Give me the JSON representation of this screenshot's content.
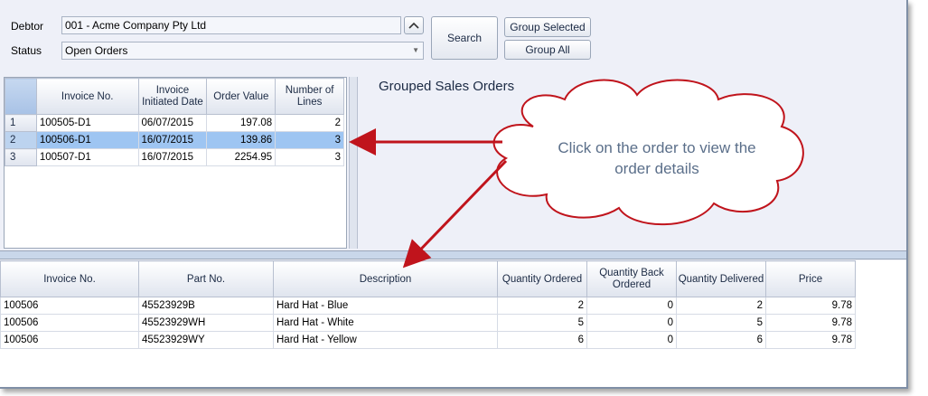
{
  "filters": {
    "debtor_label": "Debtor",
    "debtor_value": "001 - Acme Company Pty Ltd",
    "status_label": "Status",
    "status_value": "Open Orders"
  },
  "buttons": {
    "search": "Search",
    "group_selected": "Group Selected",
    "group_all": "Group All"
  },
  "orders_grid": {
    "headers": [
      "Invoice No.",
      "Invoice Initiated Date",
      "Order Value",
      "Number of Lines"
    ],
    "rows": [
      {
        "index": "1",
        "invoice": "100505-D1",
        "date": "06/07/2015",
        "value": "197.08",
        "lines": "2"
      },
      {
        "index": "2",
        "invoice": "100506-D1",
        "date": "16/07/2015",
        "value": "139.86",
        "lines": "3"
      },
      {
        "index": "3",
        "invoice": "100507-D1",
        "date": "16/07/2015",
        "value": "2254.95",
        "lines": "3"
      }
    ],
    "selected_row": 2
  },
  "grouped_panel": {
    "title": "Grouped Sales Orders"
  },
  "callout": {
    "text_line1": "Click on the order to view the",
    "text_line2": "order details"
  },
  "details_grid": {
    "headers": [
      "Invoice No.",
      "Part No.",
      "Description",
      "Quantity Ordered",
      "Quantity Back Ordered",
      "Quantity Delivered",
      "Price"
    ],
    "rows": [
      {
        "invoice": "100506",
        "part": "45523929B",
        "desc": "Hard Hat - Blue",
        "ordered": "2",
        "back": "0",
        "delivered": "2",
        "price": "9.78"
      },
      {
        "invoice": "100506",
        "part": "45523929WH",
        "desc": "Hard Hat - White",
        "ordered": "5",
        "back": "0",
        "delivered": "5",
        "price": "9.78"
      },
      {
        "invoice": "100506",
        "part": "45523929WY",
        "desc": "Hard Hat - Yellow",
        "ordered": "6",
        "back": "0",
        "delivered": "6",
        "price": "9.78"
      }
    ]
  },
  "colors": {
    "selection": "#9ec5f2",
    "arrow": "#c0141c",
    "callout_text": "#5b6f8a"
  }
}
